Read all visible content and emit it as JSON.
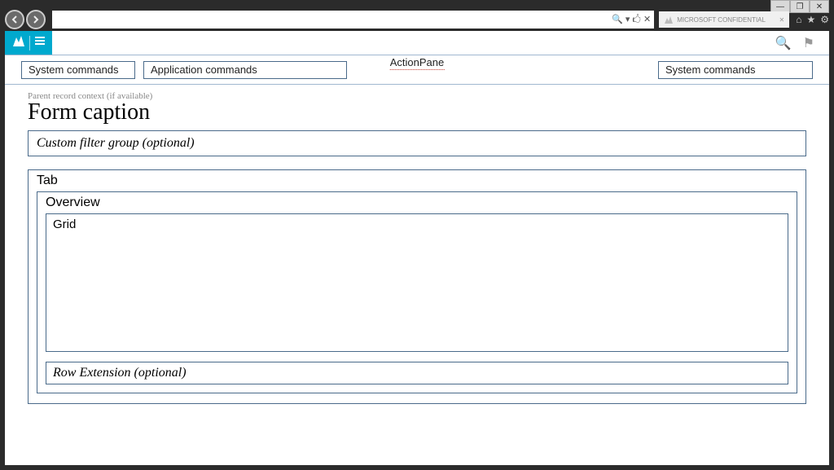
{
  "window_controls": {
    "minimize": "—",
    "maximize": "❐",
    "close": "✕"
  },
  "browser": {
    "addr_tools": "🔍 ▾ 🖒 ✕",
    "tab_title": "MICROSOFT CONFIDENTIAL",
    "chrome": {
      "home": "⌂",
      "star": "★",
      "gear": "⚙"
    }
  },
  "app_header": {
    "search_icon": "🔍",
    "flag_icon": "⚑"
  },
  "action_pane": {
    "label": "ActionPane",
    "left_cmd": "System commands",
    "mid_cmd": "Application commands",
    "right_cmd": "System commands"
  },
  "page": {
    "parent_context": "Parent record context (if available)",
    "form_caption": "Form caption",
    "filter_group": "Custom filter group (optional)",
    "tab_label": "Tab",
    "overview_label": "Overview",
    "grid_label": "Grid",
    "row_extension": "Row Extension (optional)"
  }
}
